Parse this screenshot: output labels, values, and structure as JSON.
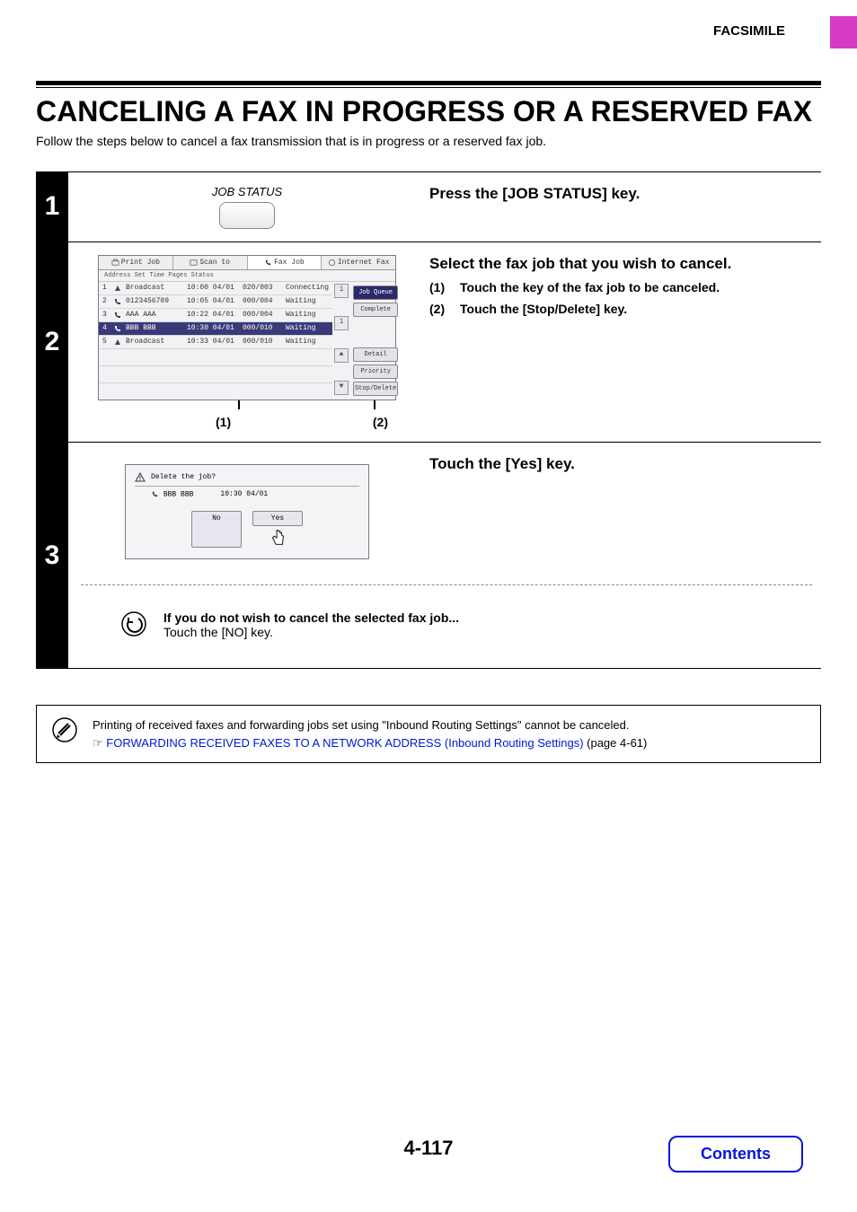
{
  "header": {
    "section": "FACSIMILE"
  },
  "title": "CANCELING A FAX IN PROGRESS OR A RESERVED FAX",
  "lead": "Follow the steps below to cancel a fax transmission that is in progress or a reserved fax job.",
  "step1": {
    "num": "1",
    "keylabel": "JOB STATUS",
    "heading": "Press the [JOB STATUS] key."
  },
  "step2": {
    "num": "2",
    "heading": "Select the fax job that you wish to cancel.",
    "sub1_n": "(1)",
    "sub1_t": "Touch the key of the fax job to be canceled.",
    "sub2_n": "(2)",
    "sub2_t": "Touch the [Stop/Delete] key.",
    "callout1": "(1)",
    "callout2": "(2)",
    "tabs": {
      "print": "Print Job",
      "scan": "Scan to",
      "fax": "Fax Job",
      "ifax": "Internet Fax"
    },
    "colhdr": "Address        Set Time   Pages   Status",
    "rows": [
      {
        "n": "1",
        "addr": "Broadcast",
        "tm": "10:00 04/01",
        "pg": "020/003",
        "st": "Connecting"
      },
      {
        "n": "2",
        "addr": "0123456789",
        "tm": "10:05 04/01",
        "pg": "000/004",
        "st": "Waiting"
      },
      {
        "n": "3",
        "addr": "AAA AAA",
        "tm": "10:22 04/01",
        "pg": "000/004",
        "st": "Waiting"
      },
      {
        "n": "4",
        "addr": "BBB BBB",
        "tm": "10:30 04/01",
        "pg": "000/010",
        "st": "Waiting"
      },
      {
        "n": "5",
        "addr": "Broadcast",
        "tm": "10:33 04/01",
        "pg": "000/010",
        "st": "Waiting"
      }
    ],
    "side": {
      "queue": "Job Queue",
      "complete": "Complete",
      "detail": "Detail",
      "priority": "Priority",
      "stop": "Stop/Delete"
    },
    "scroll": {
      "one": "1",
      "two": "1"
    }
  },
  "step3": {
    "num": "3",
    "heading": "Touch the [Yes] key.",
    "dlg_q": "Delete the job?",
    "dlg_addr": "BBB BBB",
    "dlg_time": "10:30 04/01",
    "no": "No",
    "yes": "Yes",
    "tip_b": "If you do not wish to cancel the selected fax job...",
    "tip_r": "Touch the [NO] key."
  },
  "note": {
    "line": "Printing of received faxes and forwarding jobs set using \"Inbound Routing Settings\" cannot be canceled.",
    "sym": "☞",
    "link": "FORWARDING RECEIVED FAXES TO A NETWORK ADDRESS (Inbound Routing Settings)",
    "page": " (page 4-61)"
  },
  "pagenum": "4-117",
  "contents": "Contents"
}
